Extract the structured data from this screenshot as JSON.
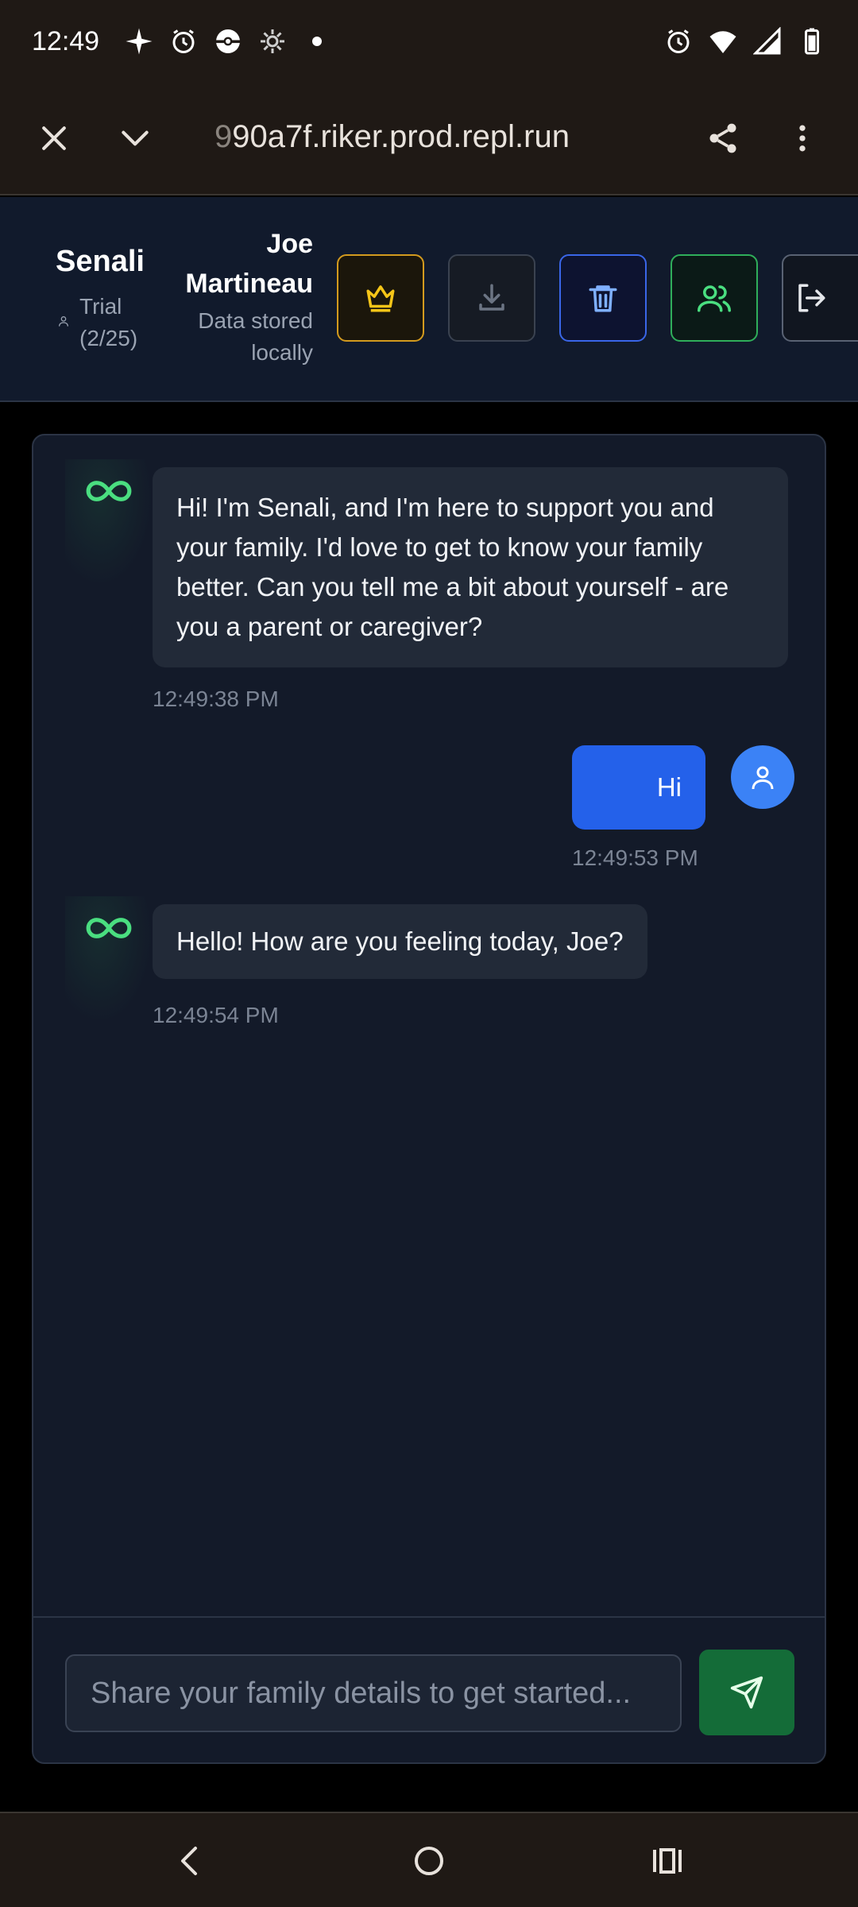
{
  "status_bar": {
    "time": "12:49",
    "icons": [
      "sparkle-icon",
      "alarm-icon",
      "pokeball-icon",
      "gear-sun-icon",
      "dot-icon",
      "alarm-icon",
      "wifi-icon",
      "signal-icon",
      "battery-icon"
    ]
  },
  "browser": {
    "url_prefix": "9",
    "url": "90a7f.riker.prod.repl.run",
    "icons": [
      "close-icon",
      "chevron-down-icon",
      "share-icon",
      "more-vert-icon"
    ]
  },
  "header": {
    "app_name": "Senali",
    "trial_label": "Trial (2/25)",
    "user_name": "Joe Martineau",
    "storage_note": "Data stored locally",
    "buttons": [
      {
        "icon": "crown-icon",
        "color": "#f5c518"
      },
      {
        "icon": "download-icon",
        "color": "#6b7483"
      },
      {
        "icon": "trash-icon",
        "color": "#7fb0ff"
      },
      {
        "icon": "users-icon",
        "color": "#4ade80"
      },
      {
        "icon": "logout-icon",
        "color": "#e5e7eb"
      }
    ]
  },
  "chat": {
    "messages": [
      {
        "sender": "bot",
        "text": "Hi! I'm Senali, and I'm here to support you and your family. I'd love to get to know your family better. Can you tell me a bit about yourself - are you a parent or caregiver?",
        "time": "12:49:38 PM"
      },
      {
        "sender": "user",
        "text": "Hi",
        "time": "12:49:53 PM"
      },
      {
        "sender": "bot",
        "text": "Hello! How are you feeling today, Joe?",
        "time": "12:49:54 PM"
      }
    ],
    "input_placeholder": "Share your family details to get started...",
    "input_value": ""
  },
  "colors": {
    "accent_green": "#4ade80",
    "user_bubble": "#2461ea",
    "send_button": "#146c38",
    "panel_bg": "#131a29"
  }
}
